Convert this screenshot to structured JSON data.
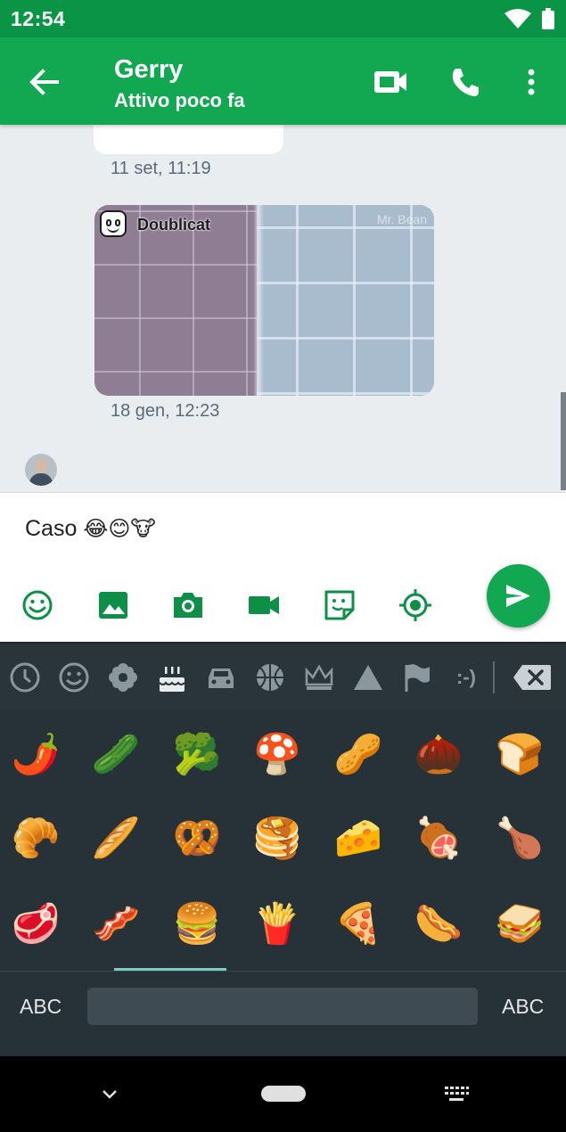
{
  "status_bar": {
    "time": "12:54",
    "icons": [
      "wifi-icon",
      "battery-icon"
    ]
  },
  "header": {
    "contact_name": "Gerry",
    "contact_status": "Attivo poco fa",
    "icons": [
      "back-arrow-icon",
      "video-camera-icon",
      "phone-icon",
      "more-vert-icon"
    ]
  },
  "chat": {
    "messages": [
      {
        "type": "text",
        "timestamp": "11 set, 11:19"
      },
      {
        "type": "media",
        "overlay_brand": "Doublicat",
        "watermark": "Mr. Bean",
        "timestamp": "18 gen, 12:23"
      }
    ]
  },
  "composer": {
    "text": "Caso",
    "emojis": "😂😊🐮",
    "tools": [
      "emoji-icon",
      "image-icon",
      "camera-icon",
      "video-icon",
      "sticker-icon",
      "location-icon"
    ],
    "send_icon": "send-icon"
  },
  "keyboard": {
    "categories": [
      "recent-clock-icon",
      "smiley-icon",
      "flower-icon",
      "cake-icon",
      "car-icon",
      "basketball-icon",
      "crown-icon",
      "triangle-icon",
      "flag-icon",
      "emoticon-text-icon"
    ],
    "emoticon_label": ":-)",
    "selected_category": "cake-icon",
    "delete_icon": "backspace-icon",
    "emoji_rows": [
      [
        "🌶️",
        "🥒",
        "🥦",
        "🍄",
        "🥜",
        "🌰",
        "🍞"
      ],
      [
        "🥐",
        "🥖",
        "🥨",
        "🥞",
        "🧀",
        "🍖",
        "🍗"
      ],
      [
        "🥩",
        "🥓",
        "🍔",
        "🍟",
        "🍕",
        "🌭",
        "🥪"
      ]
    ],
    "abc_left": "ABC",
    "abc_right": "ABC"
  },
  "nav_bar": {
    "icons": [
      "nav-back-chevron-icon",
      "nav-home-pill",
      "nav-keyboard-icon"
    ]
  },
  "colors": {
    "brand_green": "#11a851",
    "status_green": "#0a9546",
    "chat_background": "#eaedf0",
    "keyboard_background": "#263238",
    "accent_teal": "#80cbc4"
  }
}
